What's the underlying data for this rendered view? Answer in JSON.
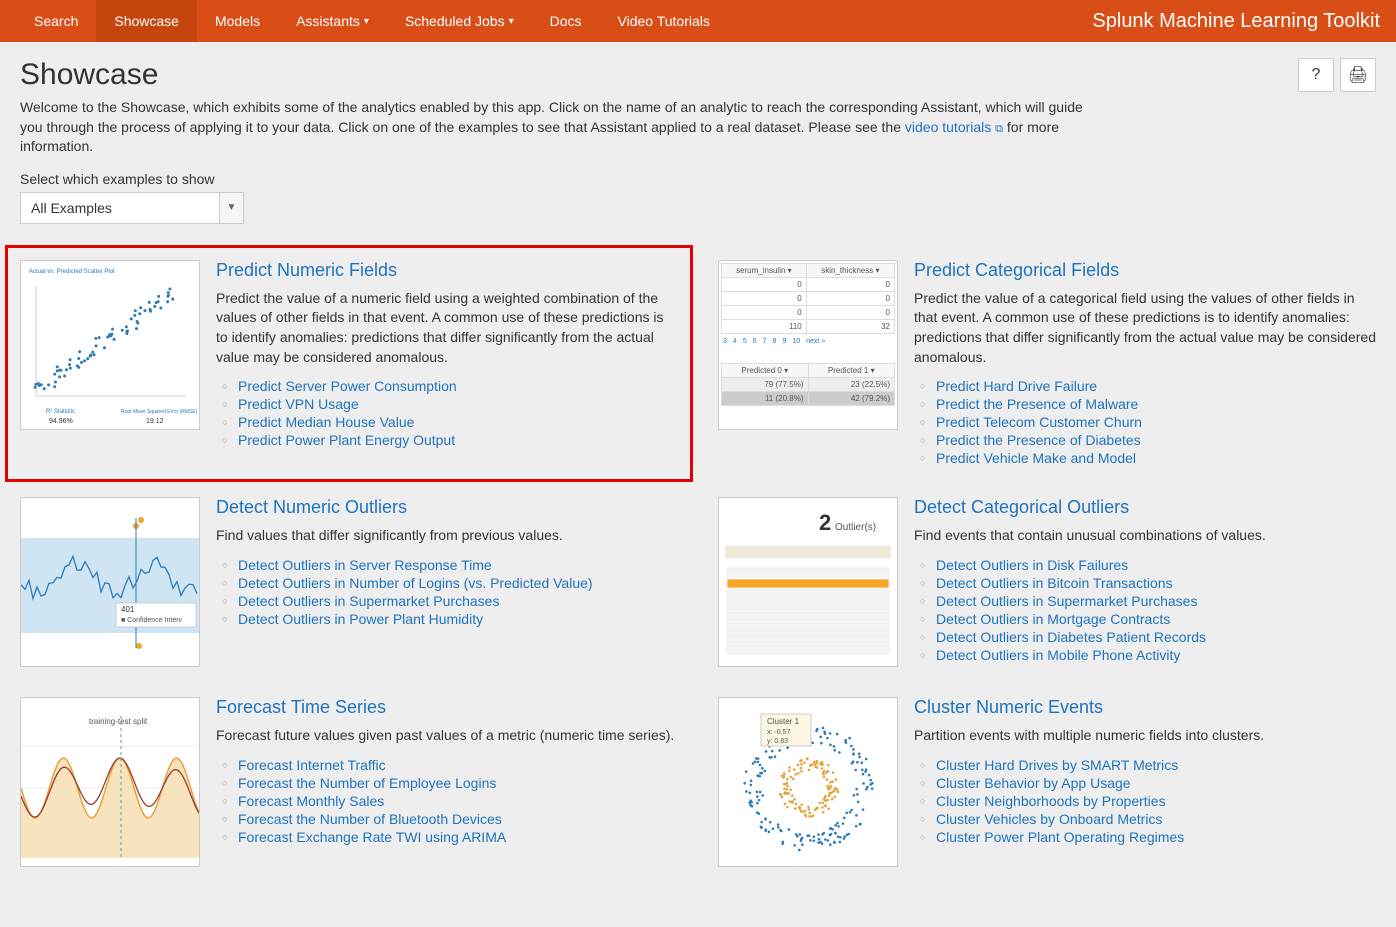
{
  "nav": {
    "items": [
      "Search",
      "Showcase",
      "Models",
      "Assistants",
      "Scheduled Jobs",
      "Docs",
      "Video Tutorials"
    ],
    "active_index": 1,
    "dropdown_indices": [
      3,
      4
    ],
    "brand": "Splunk Machine Learning Toolkit"
  },
  "header": {
    "title": "Showcase",
    "intro_before_link": "Welcome to the Showcase, which exhibits some of the analytics enabled by this app. Click on the name of an analytic to reach the corresponding Assistant, which will guide you through the process of applying it to your data. Click on one of the examples to see that Assistant applied to a real dataset. Please see the ",
    "intro_link_text": "video tutorials",
    "intro_after_link": " for more information.",
    "help_label": "?",
    "print_label": "🖨"
  },
  "filter": {
    "label": "Select which examples to show",
    "selected": "All Examples"
  },
  "cards": [
    {
      "title": "Predict Numeric Fields",
      "highlighted": true,
      "thumb": "scatter",
      "desc": "Predict the value of a numeric field using a weighted combination of the values of other fields in that event. A common use of these predictions is to identify anomalies: predictions that differ significantly from the actual value may be considered anomalous.",
      "links": [
        "Predict Server Power Consumption",
        "Predict VPN Usage",
        "Predict Median House Value",
        "Predict Power Plant Energy Output"
      ]
    },
    {
      "title": "Predict Categorical Fields",
      "highlighted": false,
      "thumb": "table",
      "desc": "Predict the value of a categorical field using the values of other fields in that event. A common use of these predictions is to identify anomalies: predictions that differ significantly from the actual value may be considered anomalous.",
      "links": [
        "Predict Hard Drive Failure",
        "Predict the Presence of Malware",
        "Predict Telecom Customer Churn",
        "Predict the Presence of Diabetes",
        "Predict Vehicle Make and Model"
      ]
    },
    {
      "title": "Detect Numeric Outliers",
      "highlighted": false,
      "thumb": "band",
      "desc": "Find values that differ significantly from previous values.",
      "links": [
        "Detect Outliers in Server Response Time",
        "Detect Outliers in Number of Logins (vs. Predicted Value)",
        "Detect Outliers in Supermarket Purchases",
        "Detect Outliers in Power Plant Humidity"
      ]
    },
    {
      "title": "Detect Categorical Outliers",
      "highlighted": false,
      "thumb": "outlier2",
      "desc": "Find events that contain unusual combinations of values.",
      "links": [
        "Detect Outliers in Disk Failures",
        "Detect Outliers in Bitcoin Transactions",
        "Detect Outliers in Supermarket Purchases",
        "Detect Outliers in Mortgage Contracts",
        "Detect Outliers in Diabetes Patient Records",
        "Detect Outliers in Mobile Phone Activity"
      ]
    },
    {
      "title": "Forecast Time Series",
      "highlighted": false,
      "thumb": "forecast",
      "desc": "Forecast future values given past values of a metric (numeric time series).",
      "links": [
        "Forecast Internet Traffic",
        "Forecast the Number of Employee Logins",
        "Forecast Monthly Sales",
        "Forecast the Number of Bluetooth Devices",
        "Forecast Exchange Rate TWI using ARIMA"
      ]
    },
    {
      "title": "Cluster Numeric Events",
      "highlighted": false,
      "thumb": "cluster",
      "desc": "Partition events with multiple numeric fields into clusters.",
      "links": [
        "Cluster Hard Drives by SMART Metrics",
        "Cluster Behavior by App Usage",
        "Cluster Neighborhoods by Properties",
        "Cluster Vehicles by Onboard Metrics",
        "Cluster Power Plant Operating Regimes"
      ]
    }
  ],
  "thumb_table": {
    "headers": [
      "serum_insulin",
      "skin_thickness"
    ],
    "rows": [
      [
        "0",
        "0"
      ],
      [
        "0",
        "0"
      ],
      [
        "0",
        "0"
      ],
      [
        "110",
        "32"
      ]
    ],
    "pager": [
      "3",
      "4",
      "5",
      "6",
      "7",
      "8",
      "9",
      "10",
      "next »"
    ],
    "pred_headers": [
      "Predicted 0",
      "Predicted 1"
    ],
    "pred_rows": [
      [
        "79 (77.5%)",
        "23 (22.5%)"
      ],
      [
        "11 (20.8%)",
        "42 (79.2%)"
      ]
    ]
  },
  "thumb_outlier2": {
    "big": "2",
    "label": "Outlier(s)"
  },
  "thumb_cluster": {
    "label": "Cluster 1",
    "x": "x: -0.57",
    "y": "y: 0.83"
  },
  "thumb_forecast": {
    "label": "training-test split"
  },
  "thumb_band": {
    "val": "401",
    "label": "■ Confidence Interv"
  },
  "thumb_scatter": {
    "title": "Actual vs. Predicted Scatter Plot",
    "r2_label": "R² Statistic",
    "r2_val": "94.96%",
    "rmse_label": "Root Mean Squared Error (RMSE)",
    "rmse_val": "19.12"
  }
}
